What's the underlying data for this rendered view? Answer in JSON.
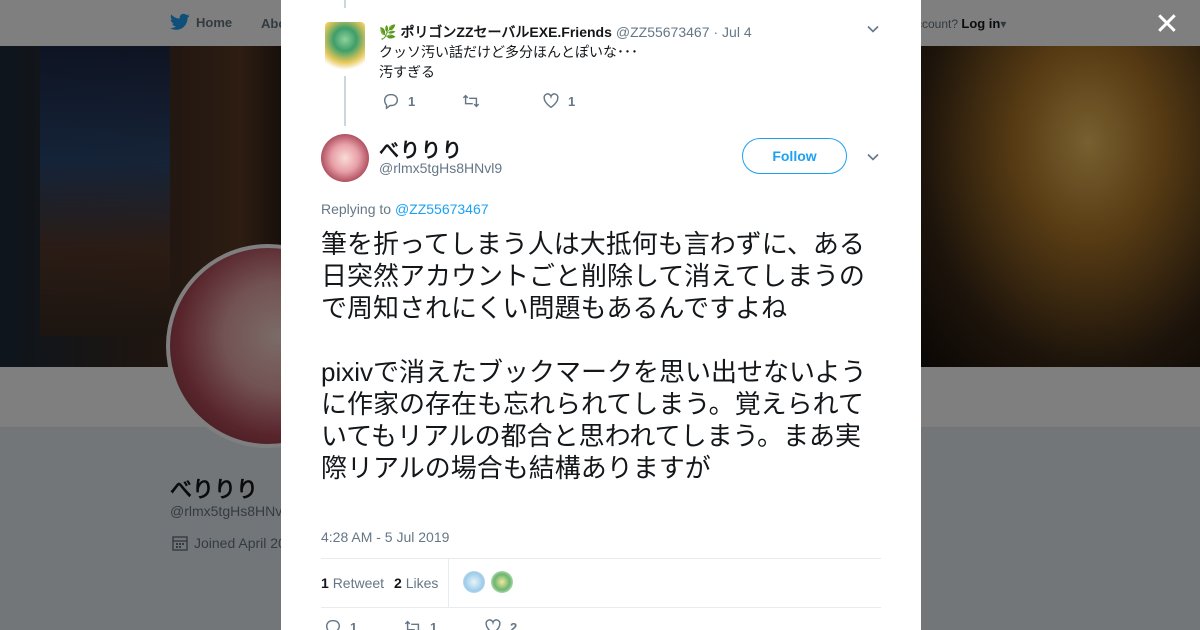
{
  "nav": {
    "home_label": "Home",
    "about_label": "Abo",
    "account_prompt": "ccount?",
    "login_label": "Log in"
  },
  "profile": {
    "name": "べりりり",
    "handle": "@rlmx5tgHs8HNv",
    "joined": "Joined April 20"
  },
  "prev_tweet": {
    "emoji": "🌿",
    "name": "ポリゴンZZセーバルEXE.Friends",
    "handle": "@ZZ55673467",
    "date": "· Jul 4",
    "text": "クッソ汚い話だけど多分ほんとぽいな･･･\n汚すぎる",
    "replies": "1",
    "retweets": "",
    "likes": "1"
  },
  "tweet": {
    "name": "べりりり",
    "handle": "@rlmx5tgHs8HNvl9",
    "follow_label": "Follow",
    "replying_prefix": "Replying to",
    "replying_to": "@ZZ55673467",
    "text": "筆を折ってしまう人は大抵何も言わずに、ある日突然アカウントごと削除して消えてしまうので周知されにくい問題もあるんですよね\n\npixivで消えたブックマークを思い出せないように作家の存在も忘れられてしまう。覚えられていてもリアルの都合と思われてしまう。まあ実際リアルの場合も結構ありますが",
    "timestamp": "4:28 AM - 5 Jul 2019",
    "retweet_count": "1",
    "retweet_label": "Retweet",
    "like_count": "2",
    "like_label": "Likes",
    "action_replies": "1",
    "action_retweets": "1",
    "action_likes": "2"
  },
  "colors": {
    "accent": "#1da1f2",
    "text": "#14171a",
    "muted": "#657786"
  }
}
